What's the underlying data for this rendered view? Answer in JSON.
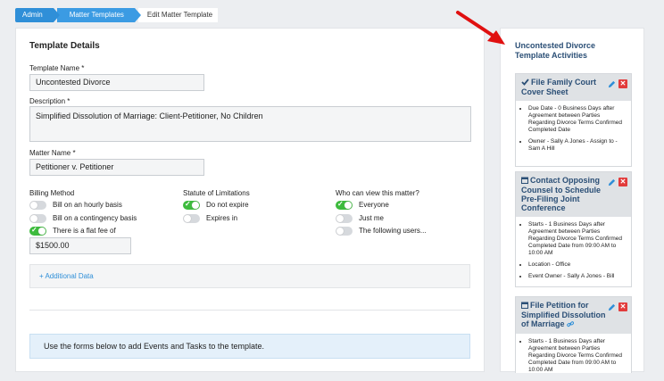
{
  "breadcrumb": {
    "admin": "Admin",
    "matter_templates": "Matter Templates",
    "current": "Edit Matter Template"
  },
  "details": {
    "title": "Template Details",
    "template_name_label": "Template Name *",
    "template_name_value": "Uncontested Divorce",
    "description_label": "Description *",
    "description_value": "Simplified Dissolution of Marriage:  Client-Petitioner, No Children",
    "matter_name_label": "Matter Name *",
    "matter_name_value": "Petitioner v. Petitioner"
  },
  "billing": {
    "label": "Billing Method",
    "options": [
      {
        "label": "Bill on an hourly basis",
        "on": false
      },
      {
        "label": "Bill on a contingency basis",
        "on": false
      },
      {
        "label": "There is a flat fee of",
        "on": true
      }
    ],
    "fee_value": "$1500.00"
  },
  "statute": {
    "label": "Statute of Limitations",
    "options": [
      {
        "label": "Do not expire",
        "on": true
      },
      {
        "label": "Expires in",
        "on": false
      }
    ]
  },
  "visibility": {
    "label": "Who can view this matter?",
    "options": [
      {
        "label": "Everyone",
        "on": true
      },
      {
        "label": "Just me",
        "on": false
      },
      {
        "label": "The following users...",
        "on": false
      }
    ]
  },
  "additional_data": "+ Additional Data",
  "info_text": "Use the forms below to add Events and Tasks to the template.",
  "activities": {
    "title": "Uncontested Divorce Template Activities",
    "cards": [
      {
        "icon": "check-icon",
        "title": "File Family Court Cover Sheet",
        "items": [
          "Due Date - 0 Business Days after Agreement between Parties Regarding Divorce Terms Confirmed Completed Date",
          "Owner - Sally A Jones - Assign to - Sam A Hill"
        ]
      },
      {
        "icon": "calendar-icon",
        "title": "Contact Opposing Counsel to Schedule Pre-Filing Joint Conference",
        "items": [
          "Starts - 1 Business Days after Agreement between Parties Regarding Divorce Terms Confirmed Completed Date from 09:00 AM to 10:00 AM",
          "Location - Office",
          "Event Owner - Sally A Jones - Bill"
        ]
      },
      {
        "icon": "calendar-icon",
        "title": "File Petition for Simplified Dissolution of Marriage",
        "items": [
          "Starts - 1 Business Days after Agreement between Parties Regarding Divorce Terms Confirmed Completed Date from 09:00 AM to 10:00 AM"
        ]
      }
    ]
  },
  "colors": {
    "accent": "#2f8fd8",
    "toggle_on": "#3dbb3d",
    "delete": "#e23b3b",
    "annotation_arrow": "#e01010"
  }
}
